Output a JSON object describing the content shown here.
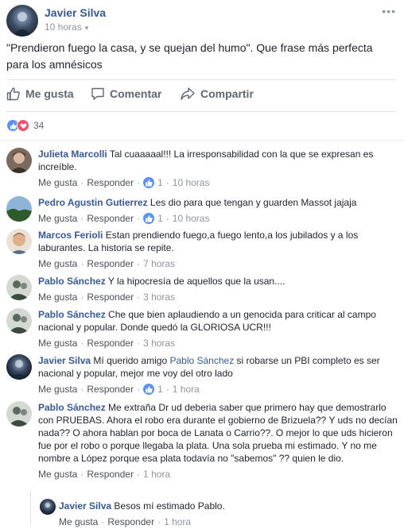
{
  "post": {
    "author": "Javier Silva",
    "time": "10 horas",
    "more": "•••",
    "text": "\"Prendieron fuego la casa, y se quejan del humo\". Que frase más perfecta para los amnésicos"
  },
  "actions": {
    "like": "Me gusta",
    "comment": "Comentar",
    "share": "Compartir"
  },
  "reactions": {
    "count": "34"
  },
  "comments": [
    {
      "name": "Julieta Marcolli",
      "text": "Tal cuaaaaal!!! La irresponsabilidad con la que se expresan es increíble.",
      "like": "Me gusta",
      "reply": "Responder",
      "likes": "1",
      "time": "10 horas"
    },
    {
      "name": "Pedro Agustin Gutierrez",
      "text": "Les dio para que tengan y guarden Massot jajaja",
      "like": "Me gusta",
      "reply": "Responder",
      "likes": "1",
      "time": "10 horas"
    },
    {
      "name": "Marcos Ferioli",
      "text": "Estan prendiendo fuego,a fuego lento,a los jubilados y a los laburantes. La historia se repite.",
      "like": "Me gusta",
      "reply": "Responder",
      "time": "7 horas"
    },
    {
      "name": "Pablo Sánchez",
      "text": "Y la hipocresía de aquellos que la usan....",
      "like": "Me gusta",
      "reply": "Responder",
      "time": "3 horas"
    },
    {
      "name": "Pablo Sánchez",
      "text": "Che que bien aplaudiendo a un genocida para criticar al campo nacional y popular. Donde quedó la GLORIOSA UCR!!!",
      "like": "Me gusta",
      "reply": "Responder",
      "time": "3 horas"
    },
    {
      "name": "Javier Silva",
      "text_before": "Mí querido amigo",
      "mention": "Pablo Sánchez",
      "text_after": "si robarse un PBI completo es ser nacional y popular, mejor me voy del otro lado",
      "like": "Me gusta",
      "reply": "Responder",
      "likes": "1",
      "time": "1 hora"
    },
    {
      "name": "Pablo Sánchez",
      "text": "Me extraña Dr ud deberia saber que primero hay que demostrarlo con PRUEBAS. Ahora el robo era durante el gobierno de Brizuela?? Y uds no decían nada?? O ahora hablan por boca de Lanata o Carrio??. O mejor lo que uds hicieron fue por el robo o porque llegaba la plata. Una sola prueba mi estimado. Y no me nombre a López porque esa plata todavía no \"sabemos\" ?? quien le dio.",
      "like": "Me gusta",
      "reply": "Responder",
      "time": "1 hora"
    }
  ],
  "reply": {
    "name": "Javier Silva",
    "text": "Besos mí estimado Pablo.",
    "like": "Me gusta",
    "reply": "Responder",
    "time": "1 hora"
  },
  "colors": {
    "link": "#365899",
    "like_blue": "#5890ff",
    "love_red": "#f25268"
  }
}
